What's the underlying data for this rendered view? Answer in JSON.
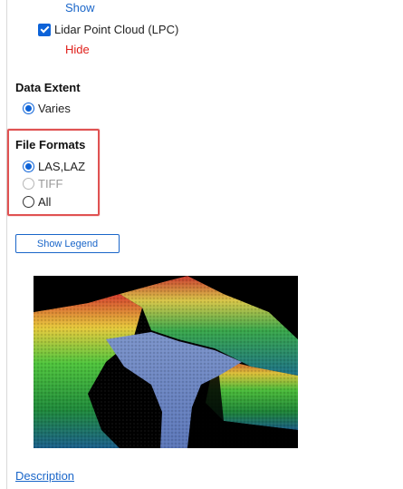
{
  "layers": [
    {
      "toggle_label": "Show"
    },
    {
      "name": "Lidar Point Cloud (LPC)",
      "checked": true,
      "toggle_label": "Hide"
    }
  ],
  "data_extent": {
    "title": "Data Extent",
    "options": [
      {
        "label": "Varies",
        "selected": true
      }
    ]
  },
  "file_formats": {
    "title": "File Formats",
    "options": [
      {
        "label": "LAS,LAZ",
        "selected": true,
        "disabled": false
      },
      {
        "label": "TIFF",
        "selected": false,
        "disabled": true
      },
      {
        "label": "All",
        "selected": false,
        "disabled": false
      }
    ]
  },
  "legend_button": {
    "label": "Show Legend"
  },
  "description_link": {
    "label": "Description"
  },
  "colors": {
    "link_blue": "#1a66c9",
    "hide_red": "#e0201b",
    "highlight": "#e05252",
    "radio_selected": "#0d63d8"
  }
}
